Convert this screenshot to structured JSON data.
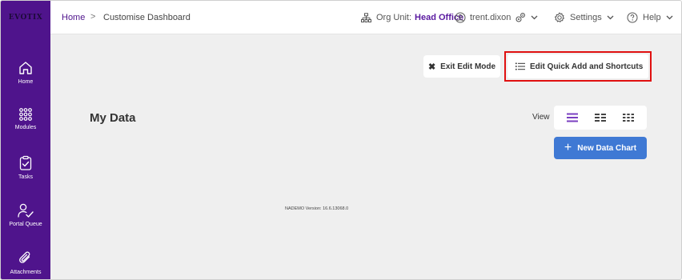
{
  "sidebar": {
    "logo_text": "EVOTIX",
    "items": [
      {
        "label": "Home",
        "icon": "home-icon"
      },
      {
        "label": "Modules",
        "icon": "grid-dots-icon"
      },
      {
        "label": "Tasks",
        "icon": "clipboard-check-icon"
      },
      {
        "label": "Portal Queue",
        "icon": "user-check-icon"
      },
      {
        "label": "Attachments",
        "icon": "paperclip-icon"
      }
    ],
    "accent_color": "#4f148c"
  },
  "header": {
    "breadcrumb_home": "Home",
    "breadcrumb_separator": ">",
    "breadcrumb_current": "Customise Dashboard",
    "org_unit_label": "Org Unit:",
    "org_unit_value": "Head Office",
    "username": "trent.dixon",
    "settings_label": "Settings",
    "help_label": "Help"
  },
  "toolbar": {
    "exit_edit_label": "Exit Edit Mode",
    "edit_quick_add_label": "Edit Quick Add and Shortcuts"
  },
  "main": {
    "section_title": "My Data",
    "view_label": "View",
    "view_options": [
      "list-view-icon",
      "two-column-view-icon",
      "three-column-view-icon"
    ],
    "new_chart_label": "New Data Chart",
    "version_text": "NADEMO Version: 16.6.13068.0"
  },
  "colors": {
    "primary_button": "#3f79d4",
    "highlight_border": "#e01010",
    "breadcrumb_link": "#4f148c"
  }
}
